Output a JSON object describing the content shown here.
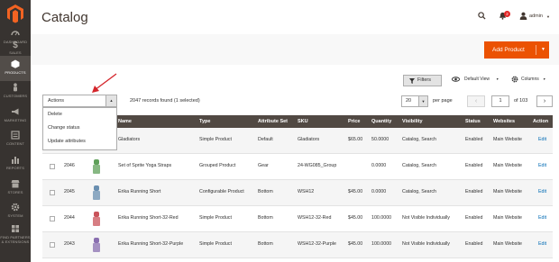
{
  "sidebar": {
    "logo": "magento-logo",
    "items": [
      {
        "label": "DASHBOARD",
        "icon": "dashboard-icon"
      },
      {
        "label": "SALES",
        "icon": "dollar-icon"
      },
      {
        "label": "PRODUCTS",
        "icon": "cube-icon",
        "active": true
      },
      {
        "label": "CUSTOMERS",
        "icon": "person-icon"
      },
      {
        "label": "MARKETING",
        "icon": "megaphone-icon"
      },
      {
        "label": "CONTENT",
        "icon": "content-icon"
      },
      {
        "label": "REPORTS",
        "icon": "bar-chart-icon"
      },
      {
        "label": "STORES",
        "icon": "store-icon"
      },
      {
        "label": "SYSTEM",
        "icon": "gear-icon"
      },
      {
        "label": "FIND PARTNERS & EXTENSIONS",
        "icon": "extensions-icon"
      }
    ]
  },
  "header": {
    "title": "Catalog",
    "notifications_count": "2",
    "user": "admin"
  },
  "action_bar": {
    "add_product_label": "Add Product"
  },
  "toolbar": {
    "filters_label": "Filters",
    "view_label": "Default View",
    "columns_label": "Columns",
    "actions_label": "Actions",
    "records_found": "2047 records found (1 selected)",
    "page_size": "20",
    "per_page_label": "per page",
    "current_page": "1",
    "of_pages": "of 103"
  },
  "actions_dropdown": {
    "items": [
      "Delete",
      "Change status",
      "Update attributes"
    ]
  },
  "table": {
    "headers": {
      "name": "Name",
      "type": "Type",
      "attribute_set": "Attribute Set",
      "sku": "SKU",
      "price": "Price",
      "quantity": "Quantity",
      "visibility": "Visibility",
      "status": "Status",
      "websites": "Websites",
      "action": "Action"
    },
    "rows": [
      {
        "id": "",
        "name": "Gladiators",
        "type": "Simple Product",
        "attribute_set": "Default",
        "sku": "Gladiators",
        "price": "$65.00",
        "quantity": "50.0000",
        "visibility": "Catalog, Search",
        "status": "Enabled",
        "websites": "Main Website",
        "action": "Edit"
      },
      {
        "id": "2046",
        "name": "Set of Sprite Yoga Straps",
        "type": "Grouped Product",
        "attribute_set": "Gear",
        "sku": "24-WG085_Group",
        "price": "",
        "quantity": "0.0000",
        "visibility": "Catalog, Search",
        "status": "Enabled",
        "websites": "Main Website",
        "action": "Edit"
      },
      {
        "id": "2045",
        "name": "Erika Running Short",
        "type": "Configurable Product",
        "attribute_set": "Bottom",
        "sku": "WSH12",
        "price": "$45.00",
        "quantity": "0.0000",
        "visibility": "Catalog, Search",
        "status": "Enabled",
        "websites": "Main Website",
        "action": "Edit"
      },
      {
        "id": "2044",
        "name": "Erika Running Short-32-Red",
        "type": "Simple Product",
        "attribute_set": "Bottom",
        "sku": "WSH12-32-Red",
        "price": "$45.00",
        "quantity": "100.0000",
        "visibility": "Not Visible Individually",
        "status": "Enabled",
        "websites": "Main Website",
        "action": "Edit"
      },
      {
        "id": "2043",
        "name": "Erika Running Short-32-Purple",
        "type": "Simple Product",
        "attribute_set": "Bottom",
        "sku": "WSH12-32-Purple",
        "price": "$45.00",
        "quantity": "100.0000",
        "visibility": "Not Visible Individually",
        "status": "Enabled",
        "websites": "Main Website",
        "action": "Edit"
      }
    ]
  },
  "colors": {
    "sidebar_bg": "#373330",
    "accent_orange": "#eb5202",
    "table_header_bg": "#514943",
    "link_blue": "#006bb4",
    "arrow_red": "#d4252b"
  }
}
